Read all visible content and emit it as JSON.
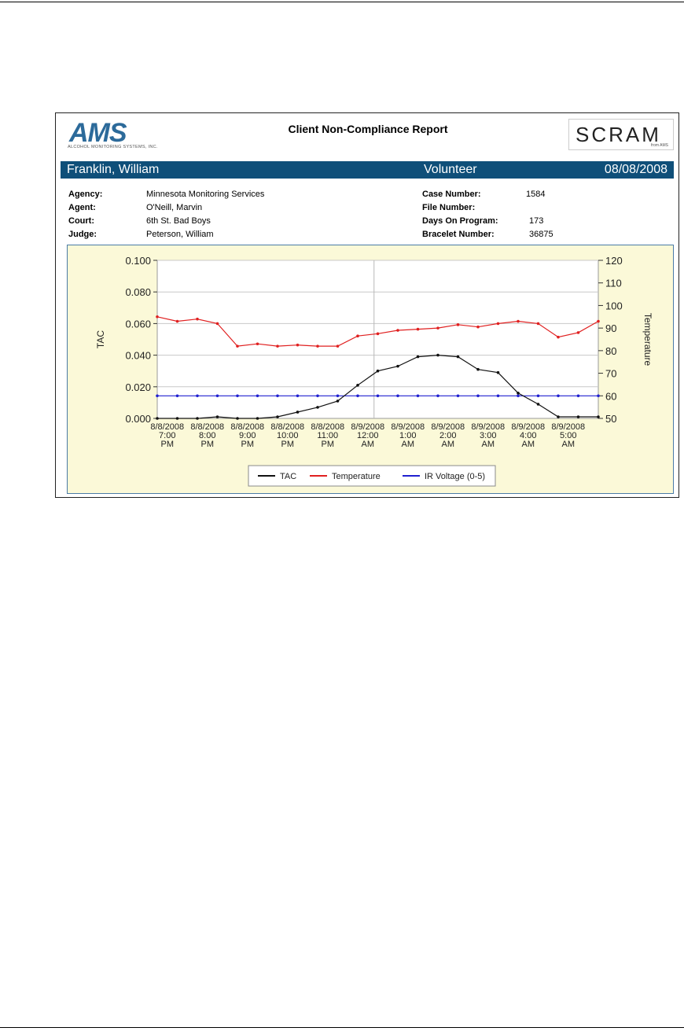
{
  "report": {
    "title": "Client Non-Compliance Report",
    "ams_logo": "AMS",
    "ams_tagline": "ALCOHOL MONITORING SYSTEMS, INC.",
    "scram_logo": "SCRAM",
    "scram_sub": "from AMS",
    "client_name": "Franklin, William",
    "status": "Volunteer",
    "date": "08/08/2008",
    "banner_color": "#0f4f79"
  },
  "info": {
    "agency_label": "Agency:",
    "agency": "Minnesota Monitoring Services",
    "agent_label": "Agent:",
    "agent": "O'Neill, Marvin",
    "court_label": "Court:",
    "court": "6th St. Bad Boys",
    "judge_label": "Judge:",
    "judge": "Peterson, William",
    "case_label": "Case Number:",
    "case": "1584",
    "file_label": "File Number:",
    "file": "",
    "days_label": "Days On Program:",
    "days": "173",
    "bracelet_label": "Bracelet Number:",
    "bracelet": "36875"
  },
  "chart_data": {
    "type": "line",
    "title": "",
    "ylabel": "TAC",
    "y2label": "Temperature",
    "ylim": [
      0,
      0.1
    ],
    "yticks": [
      "0.000",
      "0.020",
      "0.040",
      "0.060",
      "0.080",
      "0.100"
    ],
    "y2lim": [
      50,
      120
    ],
    "y2ticks": [
      "50",
      "60",
      "70",
      "80",
      "90",
      "100",
      "110",
      "120"
    ],
    "xlim": [
      0,
      22
    ],
    "xticks": [
      {
        "x": 0.5,
        "lines": [
          "8/8/2008",
          "7:00",
          "PM"
        ]
      },
      {
        "x": 2.5,
        "lines": [
          "8/8/2008",
          "8:00",
          "PM"
        ]
      },
      {
        "x": 4.5,
        "lines": [
          "8/8/2008",
          "9:00",
          "PM"
        ]
      },
      {
        "x": 6.5,
        "lines": [
          "8/8/2008",
          "10:00",
          "PM"
        ]
      },
      {
        "x": 8.5,
        "lines": [
          "8/8/2008",
          "11:00",
          "PM"
        ]
      },
      {
        "x": 10.5,
        "lines": [
          "8/9/2008",
          "12:00",
          "AM"
        ]
      },
      {
        "x": 12.5,
        "lines": [
          "8/9/2008",
          "1:00",
          "AM"
        ]
      },
      {
        "x": 14.5,
        "lines": [
          "8/9/2008",
          "2:00",
          "AM"
        ]
      },
      {
        "x": 16.5,
        "lines": [
          "8/9/2008",
          "3:00",
          "AM"
        ]
      },
      {
        "x": 18.5,
        "lines": [
          "8/9/2008",
          "4:00",
          "AM"
        ]
      },
      {
        "x": 20.5,
        "lines": [
          "8/9/2008",
          "5:00",
          "AM"
        ]
      }
    ],
    "grid": true,
    "legend_position": "bottom-center",
    "series": [
      {
        "name": "TAC",
        "axis": "left",
        "color": "#111111",
        "x": [
          0,
          1,
          2,
          3,
          4,
          5,
          6,
          7,
          8,
          9,
          10,
          11,
          12,
          13,
          14,
          15,
          16,
          17,
          18,
          19,
          20,
          21,
          22
        ],
        "values": [
          0.0,
          0.0,
          0.0,
          0.001,
          0.0,
          0.0,
          0.001,
          0.004,
          0.007,
          0.011,
          0.021,
          0.03,
          0.033,
          0.039,
          0.04,
          0.039,
          0.031,
          0.029,
          0.016,
          0.009,
          0.001,
          0.001,
          0.001
        ]
      },
      {
        "name": "Temperature",
        "axis": "right",
        "color": "#e02020",
        "x": [
          0,
          1,
          2,
          3,
          4,
          5,
          6,
          7,
          8,
          9,
          10,
          11,
          12,
          13,
          14,
          15,
          16,
          17,
          18,
          19,
          20,
          21,
          22
        ],
        "values": [
          95,
          93,
          94,
          92,
          82,
          83,
          82,
          82.5,
          82,
          82,
          86.5,
          87.5,
          89,
          89.5,
          90,
          91.5,
          90.5,
          92,
          93,
          92,
          86,
          88,
          93
        ]
      },
      {
        "name": "IR Voltage (0-5)",
        "axis": "right",
        "color": "#2020d0",
        "x": [
          0,
          1,
          2,
          3,
          4,
          5,
          6,
          7,
          8,
          9,
          10,
          11,
          12,
          13,
          14,
          15,
          16,
          17,
          18,
          19,
          20,
          21,
          22
        ],
        "values": [
          60,
          60,
          60,
          60,
          60,
          60,
          60,
          60,
          60,
          60,
          60,
          60,
          60,
          60,
          60,
          60,
          60,
          60,
          60,
          60,
          60,
          60,
          60
        ]
      }
    ]
  }
}
